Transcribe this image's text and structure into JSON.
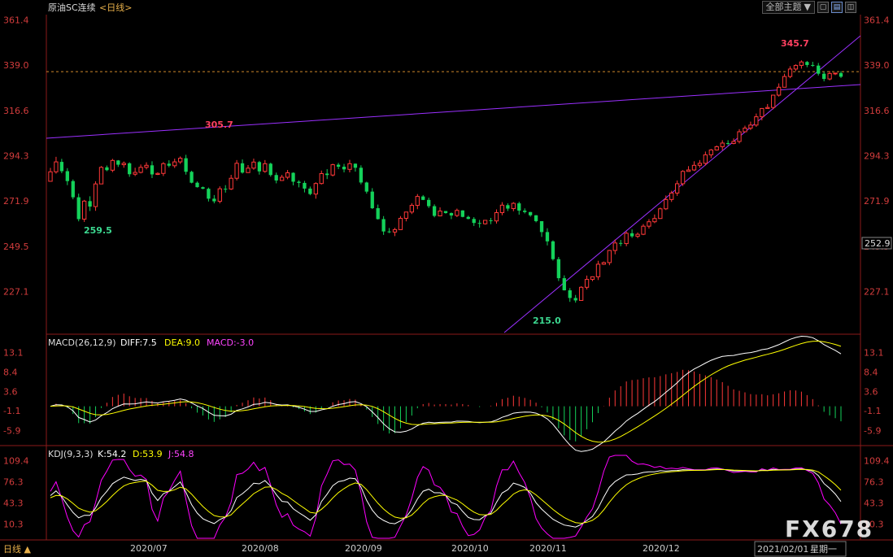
{
  "header": {
    "title": "原油SC连续",
    "period": "<日线>",
    "theme_button": "全部主题",
    "theme_arrow": "▼",
    "icons": [
      "restore-icon",
      "maximize-icon",
      "layout-icon"
    ]
  },
  "colors": {
    "up": "#ff3838",
    "down": "#14d25a",
    "trend": "#9b30ff",
    "last_price_line": "#d08a2a",
    "axis_text": "#d23c3c",
    "diff": "#ffffff",
    "dea": "#ffff00",
    "kdj_k": "#ffffff",
    "kdj_d": "#ffff00",
    "kdj_j": "#ff00ff"
  },
  "main_axis": {
    "ticks": [
      "361.4",
      "339.0",
      "316.6",
      "294.3",
      "271.9",
      "249.5",
      "227.1"
    ],
    "tick_values": [
      361.4,
      339.0,
      316.6,
      294.3,
      271.9,
      249.5,
      227.1
    ],
    "last_price": "252.9",
    "ref_line_value": 335.8
  },
  "annotations": {
    "high_label": "345.7",
    "mid_high_label": "305.7",
    "low1_label": "259.5",
    "low2_label": "215.0"
  },
  "macd": {
    "label_name": "MACD(26,12,9)",
    "label_diff": "DIFF:7.5",
    "label_dea": "DEA:9.0",
    "label_macd": "MACD:-3.0",
    "ticks": [
      "13.1",
      "8.4",
      "3.6",
      "-1.1",
      "-5.9"
    ],
    "tick_values": [
      13.1,
      8.4,
      3.6,
      -1.1,
      -5.9
    ]
  },
  "kdj": {
    "label_name": "KDJ(9,3,3)",
    "label_k": "K:54.2",
    "label_d": "D:53.9",
    "label_j": "J:54.8",
    "ticks": [
      "109.4",
      "76.3",
      "43.3",
      "10.3"
    ],
    "tick_values": [
      109.4,
      76.3,
      43.3,
      10.3
    ]
  },
  "xaxis": {
    "labels": [
      "2020/07",
      "2020/08",
      "2020/09",
      "2020/10",
      "2020/11",
      "2020/12"
    ],
    "cursor_date": "2021/02/01",
    "cursor_weekday": "星期一",
    "bottom_left": "日线 ▲"
  },
  "watermark": "FX678",
  "chart_data": {
    "type": "candlestick",
    "title": "原油SC连续",
    "period": "日线",
    "ylim": [
      206,
      364
    ],
    "marked_high": 345.7,
    "marked_low": 215.0,
    "last_price": 252.9,
    "current_ref": 335.8,
    "candles": [
      [
        281.6,
        286.3,
        282.8,
        288.2
      ],
      [
        286.3,
        291.2,
        285.4,
        293.7
      ],
      [
        291.2,
        286.6,
        285.6,
        292.7
      ],
      [
        286.6,
        281.7,
        279.7,
        288.1
      ],
      [
        281.7,
        273.7,
        272.7,
        282.5
      ],
      [
        273.7,
        262.9,
        261.8,
        275.5
      ],
      [
        262.9,
        271.8,
        261.5,
        272.4
      ],
      [
        271.8,
        269.1,
        266.9,
        274.2
      ],
      [
        269.1,
        280.3,
        267.0,
        281.6
      ],
      [
        280.3,
        288.5,
        280.2,
        289.1
      ],
      [
        288.5,
        287.1,
        286.6,
        289.4
      ],
      [
        287.1,
        291.9,
        286.1,
        292.7
      ],
      [
        291.9,
        289.8,
        288.7,
        292.1
      ],
      [
        289.8,
        290.5,
        288.3,
        291.4
      ],
      [
        290.5,
        285.1,
        283.8,
        291.0
      ],
      [
        285.1,
        286.0,
        284.2,
        288.3
      ],
      [
        286.0,
        288.5,
        285.5,
        289.9
      ],
      [
        288.5,
        289.5,
        287.5,
        291.0
      ],
      [
        289.5,
        285.0,
        283.2,
        291.5
      ],
      [
        285.0,
        285.5,
        284.7,
        286.0
      ],
      [
        285.5,
        290.3,
        284.2,
        291.1
      ],
      [
        290.3,
        289.3,
        288.5,
        292.0
      ],
      [
        289.3,
        291.2,
        288.2,
        292.8
      ],
      [
        291.2,
        293.0,
        290.2,
        293.9
      ],
      [
        293.0,
        286.3,
        284.9,
        294.7
      ],
      [
        286.3,
        280.9,
        280.6,
        286.8
      ],
      [
        280.9,
        278.7,
        278.5,
        281.5
      ],
      [
        278.7,
        277.9,
        277.7,
        279.0
      ],
      [
        277.9,
        273.0,
        271.6,
        278.5
      ],
      [
        273.0,
        271.7,
        270.7,
        274.8
      ],
      [
        271.7,
        277.9,
        270.7,
        279.1
      ],
      [
        277.9,
        277.8,
        276.0,
        279.7
      ],
      [
        277.8,
        283.1,
        277.3,
        284.8
      ],
      [
        283.1,
        290.5,
        282.0,
        292.1
      ],
      [
        290.5,
        285.9,
        285.4,
        292.4
      ],
      [
        285.9,
        288.1,
        285.8,
        289.6
      ],
      [
        288.1,
        291.1,
        287.3,
        292.8
      ],
      [
        291.1,
        286.5,
        284.9,
        291.7
      ],
      [
        286.5,
        290.3,
        285.8,
        292.1
      ],
      [
        290.3,
        284.7,
        283.9,
        290.8
      ],
      [
        284.7,
        282.0,
        280.6,
        285.9
      ],
      [
        282.0,
        283.6,
        281.9,
        284.8
      ],
      [
        283.6,
        285.8,
        282.6,
        287.2
      ],
      [
        285.8,
        281.4,
        279.6,
        286.0
      ],
      [
        281.4,
        280.8,
        278.6,
        282.1
      ],
      [
        280.8,
        278.0,
        276.1,
        281.8
      ],
      [
        278.0,
        275.3,
        274.7,
        279.0
      ],
      [
        275.3,
        280.5,
        273.0,
        281.1
      ],
      [
        280.5,
        285.4,
        280.0,
        286.9
      ],
      [
        285.4,
        284.7,
        282.7,
        287.6
      ],
      [
        284.7,
        289.8,
        284.0,
        290.3
      ],
      [
        289.8,
        288.8,
        287.6,
        290.7
      ],
      [
        288.8,
        287.5,
        286.0,
        290.2
      ],
      [
        287.5,
        290.3,
        286.0,
        292.2
      ],
      [
        290.3,
        288.3,
        286.4,
        290.4
      ],
      [
        288.3,
        281.0,
        280.1,
        289.5
      ],
      [
        281.0,
        276.5,
        275.5,
        281.4
      ],
      [
        276.5,
        268.3,
        267.9,
        278.2
      ],
      [
        268.3,
        262.9,
        262.7,
        270.1
      ],
      [
        262.9,
        256.8,
        255.1,
        264.4
      ],
      [
        256.8,
        256.5,
        256.0,
        258.5
      ],
      [
        256.5,
        257.7,
        254.5,
        258.6
      ],
      [
        257.7,
        263.3,
        257.5,
        264.4
      ],
      [
        263.3,
        266.4,
        261.8,
        266.5
      ],
      [
        266.4,
        269.7,
        265.4,
        270.8
      ],
      [
        269.7,
        274.1,
        267.8,
        275.3
      ],
      [
        274.1,
        272.4,
        272.3,
        274.8
      ],
      [
        272.4,
        269.3,
        268.4,
        273.5
      ],
      [
        269.3,
        264.5,
        263.8,
        270.2
      ],
      [
        264.5,
        266.9,
        264.4,
        268.7
      ],
      [
        266.9,
        265.9,
        265.6,
        266.9
      ],
      [
        265.9,
        264.7,
        262.9,
        266.2
      ],
      [
        264.7,
        267.2,
        263.9,
        268.1
      ],
      [
        267.2,
        264.0,
        263.8,
        267.3
      ],
      [
        264.0,
        263.0,
        262.8,
        264.6
      ],
      [
        263.0,
        261.0,
        259.5,
        263.9
      ],
      [
        261.0,
        260.6,
        258.7,
        262.5
      ],
      [
        260.6,
        262.3,
        260.2,
        262.4
      ],
      [
        262.3,
        262.0,
        260.4,
        263.5
      ],
      [
        262.0,
        266.1,
        260.7,
        267.7
      ],
      [
        266.1,
        269.8,
        264.8,
        271.3
      ],
      [
        269.8,
        268.1,
        266.9,
        270.7
      ],
      [
        268.1,
        270.7,
        266.8,
        271.3
      ],
      [
        270.7,
        267.1,
        265.1,
        271.5
      ],
      [
        267.1,
        266.4,
        265.7,
        268.2
      ],
      [
        266.4,
        264.8,
        264.1,
        266.5
      ],
      [
        264.8,
        261.9,
        261.3,
        264.9
      ],
      [
        261.9,
        256.5,
        254.1,
        261.9
      ],
      [
        256.5,
        251.9,
        249.9,
        258.4
      ],
      [
        251.9,
        243.1,
        242.4,
        252.4
      ],
      [
        243.1,
        233.7,
        232.3,
        244.2
      ],
      [
        233.7,
        227.7,
        227.6,
        235.1
      ],
      [
        227.7,
        223.9,
        222.0,
        228.8
      ],
      [
        223.9,
        222.7,
        221.6,
        225.4
      ],
      [
        222.7,
        229.2,
        222.5,
        229.7
      ],
      [
        229.2,
        233.1,
        228.1,
        235.0
      ],
      [
        233.1,
        234.4,
        232.2,
        234.6
      ],
      [
        234.4,
        240.6,
        232.8,
        242.3
      ],
      [
        240.6,
        241.4,
        240.3,
        241.9
      ],
      [
        241.4,
        247.4,
        240.1,
        247.7
      ],
      [
        247.4,
        251.1,
        245.5,
        252.8
      ],
      [
        251.1,
        250.8,
        249.5,
        252.6
      ],
      [
        250.8,
        255.9,
        249.5,
        256.8
      ],
      [
        255.9,
        254.4,
        253.6,
        257.8
      ],
      [
        254.4,
        255.4,
        253.5,
        256.3
      ],
      [
        255.4,
        259.4,
        255.0,
        260.5
      ],
      [
        259.4,
        261.6,
        258.2,
        262.9
      ],
      [
        261.6,
        263.2,
        260.9,
        265.2
      ],
      [
        263.2,
        268.0,
        263.0,
        268.6
      ],
      [
        268.0,
        272.6,
        267.4,
        274.6
      ],
      [
        272.6,
        275.8,
        271.4,
        276.9
      ],
      [
        275.8,
        280.4,
        274.4,
        282.0
      ],
      [
        280.4,
        286.5,
        279.3,
        287.1
      ],
      [
        286.5,
        287.2,
        286.4,
        289.1
      ],
      [
        287.2,
        289.5,
        286.7,
        291.5
      ],
      [
        289.5,
        290.5,
        288.3,
        292.1
      ],
      [
        290.5,
        294.7,
        289.4,
        296.3
      ],
      [
        294.7,
        297.1,
        293.1,
        297.6
      ],
      [
        297.1,
        298.7,
        296.8,
        299.3
      ],
      [
        298.7,
        300.5,
        296.9,
        301.9
      ],
      [
        300.5,
        300.3,
        299.4,
        301.9
      ],
      [
        300.3,
        301.3,
        299.9,
        302.8
      ],
      [
        301.3,
        306.1,
        300.3,
        307.4
      ],
      [
        306.1,
        307.9,
        305.8,
        309.1
      ],
      [
        307.9,
        309.4,
        306.9,
        311.1
      ],
      [
        309.4,
        313.5,
        308.5,
        315.1
      ],
      [
        313.5,
        317.6,
        311.7,
        317.8
      ],
      [
        317.6,
        318.1,
        317.5,
        319.8
      ],
      [
        318.1,
        324.2,
        317.2,
        324.4
      ],
      [
        324.2,
        328.1,
        323.5,
        330.0
      ],
      [
        328.1,
        333.4,
        328.0,
        334.8
      ],
      [
        333.4,
        337.1,
        332.6,
        338.5
      ],
      [
        337.1,
        338.9,
        336.1,
        339.4
      ],
      [
        338.9,
        340.6,
        337.3,
        341.4
      ],
      [
        340.6,
        339.1,
        338.0,
        341.1
      ],
      [
        339.1,
        338.8,
        338.2,
        340.7
      ],
      [
        338.8,
        334.8,
        333.9,
        340.1
      ],
      [
        334.8,
        332.2,
        331.0,
        335.9
      ],
      [
        332.2,
        334.9,
        331.5,
        336.1
      ],
      [
        334.9,
        335.1,
        334.1,
        335.1
      ],
      [
        335.1,
        333.3,
        332.7,
        336.0
      ]
    ]
  }
}
